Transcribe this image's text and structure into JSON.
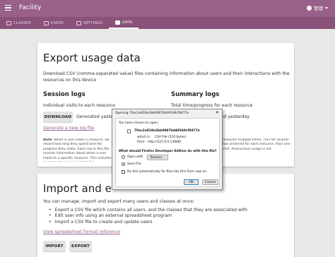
{
  "appbar": {
    "title": "Facility",
    "user": "管理",
    "background": "#996189"
  },
  "tabs": [
    {
      "label": "CLASSES",
      "icon": "classes-icon"
    },
    {
      "label": "USERS",
      "icon": "users-icon"
    },
    {
      "label": "SETTINGS",
      "icon": "settings-icon"
    },
    {
      "label": "DATA",
      "icon": "data-icon",
      "active": true
    }
  ],
  "export": {
    "title": "Export usage data",
    "description": "Download CSV (comma-separated value) files containing information about users and their interactions with the resources on this device",
    "session": {
      "heading": "Session logs",
      "text": "Individual visits to each resource",
      "button": "DOWNLOAD",
      "generated": "Generated yesterday.",
      "link": "Generate a new log file"
    },
    "summary": {
      "heading": "Summary logs",
      "text": "Total time/progress for each resource",
      "generated": "Generated yesterday."
    },
    "note_label": "Note",
    "note_left": ": When a user views a resource, we record how long they spend and the progress they make. Each row in this file records information about when a user made to a specific resource. This includes an anonymous user is signed in.",
    "note_right": "resource multiple times. This file records has achieved for each resource. than one visit. Anonymous usage is not"
  },
  "import": {
    "title": "Import and export users",
    "description": "You can manage, import and export many users and classes at once:",
    "bullets": [
      "Export a CSV file which contains all users, and the classes that they are associated with",
      "Edit user info using an external spreadsheet program",
      "Import a CSV file to create and update users"
    ],
    "link": "View spreadsheet format reference",
    "buttons": [
      "IMPORT",
      "EXPORT"
    ]
  },
  "dialog": {
    "title": "Opening 70ac2e819e2bb00876d49549cf9477e",
    "close": "✕",
    "opening": "You have chosen to open:",
    "filename": "70ac2e819e2bb00876d49549cf9477e",
    "which_is": "which is:",
    "type": "CSV File (510 bytes)",
    "from_label": "from:",
    "from": "http://127.0.0.1:8080",
    "question": "What should Firefox Developer Edition do with this file?",
    "open_with": "Open with",
    "browse": "Browse...",
    "save_file": "Save File",
    "auto_label": "Do this automatically for files like this from now on.",
    "ok": "OK",
    "cancel": "Cancel"
  }
}
